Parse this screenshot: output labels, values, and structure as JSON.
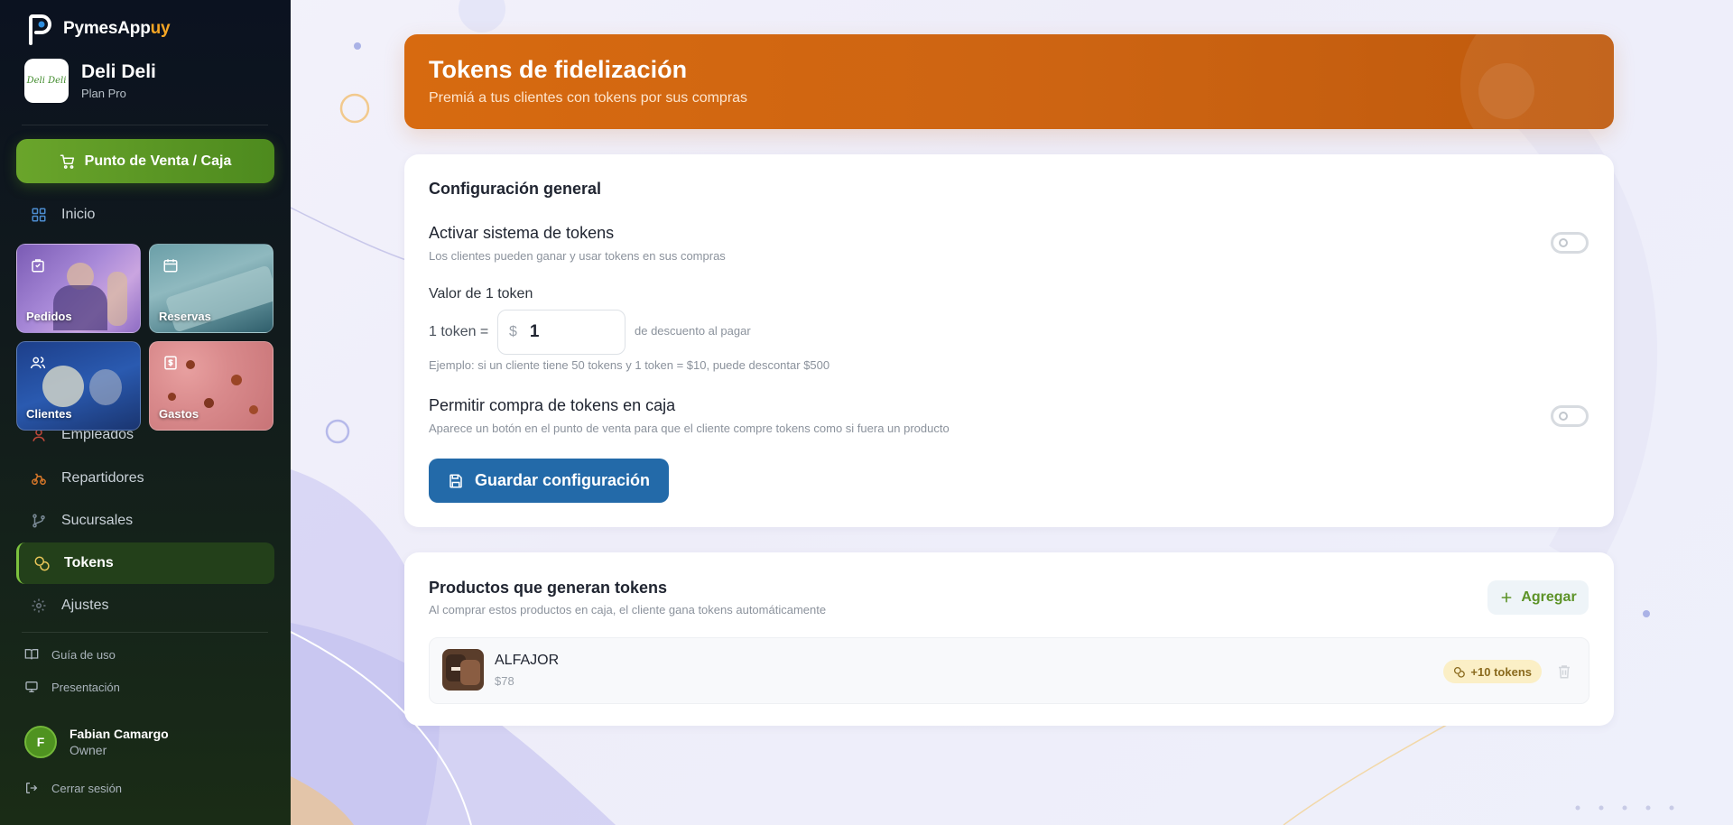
{
  "brand": {
    "name": "PymesApp",
    "name_accent": "uy"
  },
  "business": {
    "name": "Deli Deli",
    "plan": "Plan Pro",
    "logo_text": "Deli Deli"
  },
  "sidebar": {
    "pos_button": "Punto de Venta / Caja",
    "home": "Inicio",
    "tiles": [
      {
        "label": "Pedidos",
        "icon": "bag-icon"
      },
      {
        "label": "Reservas",
        "icon": "calendar-icon"
      },
      {
        "label": "Clientes",
        "icon": "users-icon"
      },
      {
        "label": "Gastos",
        "icon": "receipt-icon"
      }
    ],
    "partial_item": "Empleados",
    "items": [
      {
        "label": "Repartidores",
        "icon": "bike-icon"
      },
      {
        "label": "Sucursales",
        "icon": "branch-icon"
      },
      {
        "label": "Tokens",
        "icon": "coins-icon",
        "active": true
      },
      {
        "label": "Ajustes",
        "icon": "gear-icon"
      }
    ],
    "guide": "Guía de uso",
    "presentation": "Presentación",
    "user": {
      "initial": "F",
      "name": "Fabian Camargo",
      "role": "Owner"
    },
    "logout": "Cerrar sesión"
  },
  "hero": {
    "title": "Tokens de fidelización",
    "subtitle": "Premiá a tus clientes con tokens por sus compras"
  },
  "config": {
    "title": "Configuración general",
    "activate": {
      "title": "Activar sistema de tokens",
      "desc": "Los clientes pueden ganar y usar tokens en sus compras",
      "enabled": false
    },
    "value": {
      "label": "Valor de 1 token",
      "prefix": "1 token =",
      "currency": "$",
      "amount": "1",
      "suffix": "de descuento al pagar",
      "example": "Ejemplo: si un cliente tiene 50 tokens y 1 token = $10, puede descontar $500"
    },
    "purchase": {
      "title": "Permitir compra de tokens en caja",
      "desc": "Aparece un botón en el punto de venta para que el cliente compre tokens como si fuera un producto",
      "enabled": false
    },
    "save_button": "Guardar configuración"
  },
  "products": {
    "title": "Productos que generan tokens",
    "desc": "Al comprar estos productos en caja, el cliente gana tokens automáticamente",
    "add_button": "Agregar",
    "items": [
      {
        "name": "ALFAJOR",
        "price": "$78",
        "tokens": "+10 tokens"
      }
    ]
  },
  "colors": {
    "accent": "#d76a10",
    "green": "#5d9328",
    "blue": "#236aa9"
  }
}
